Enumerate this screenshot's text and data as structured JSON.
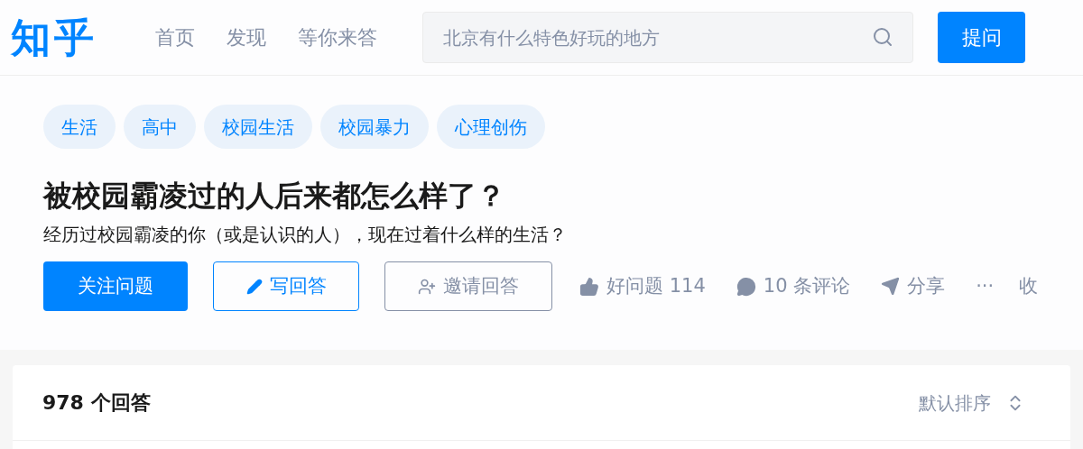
{
  "header": {
    "logo": "知乎",
    "nav": [
      "首页",
      "发现",
      "等你来答"
    ],
    "search": {
      "placeholder": "北京有什么特色好玩的地方"
    },
    "ask_button": "提问"
  },
  "question": {
    "topics": [
      "生活",
      "高中",
      "校园生活",
      "校园暴力",
      "心理创伤"
    ],
    "title": "被校园霸凌过的人后来都怎么样了？",
    "description": "经历过校园霸凌的你（或是认识的人），现在过着什么样的生活？",
    "actions": [
      {
        "kind": "primary",
        "label": "关注问题"
      },
      {
        "kind": "write",
        "label": "写回答"
      },
      {
        "kind": "invite",
        "label": "邀请回答"
      },
      {
        "kind": "like",
        "label": "好问题 114"
      },
      {
        "kind": "comment",
        "label": "10 条评论"
      },
      {
        "kind": "share",
        "label": "分享"
      },
      {
        "kind": "more",
        "label": "···"
      },
      {
        "kind": "text",
        "label": "收"
      }
    ]
  },
  "answers": {
    "count": "978 个回答",
    "sort": "默认排序"
  }
}
